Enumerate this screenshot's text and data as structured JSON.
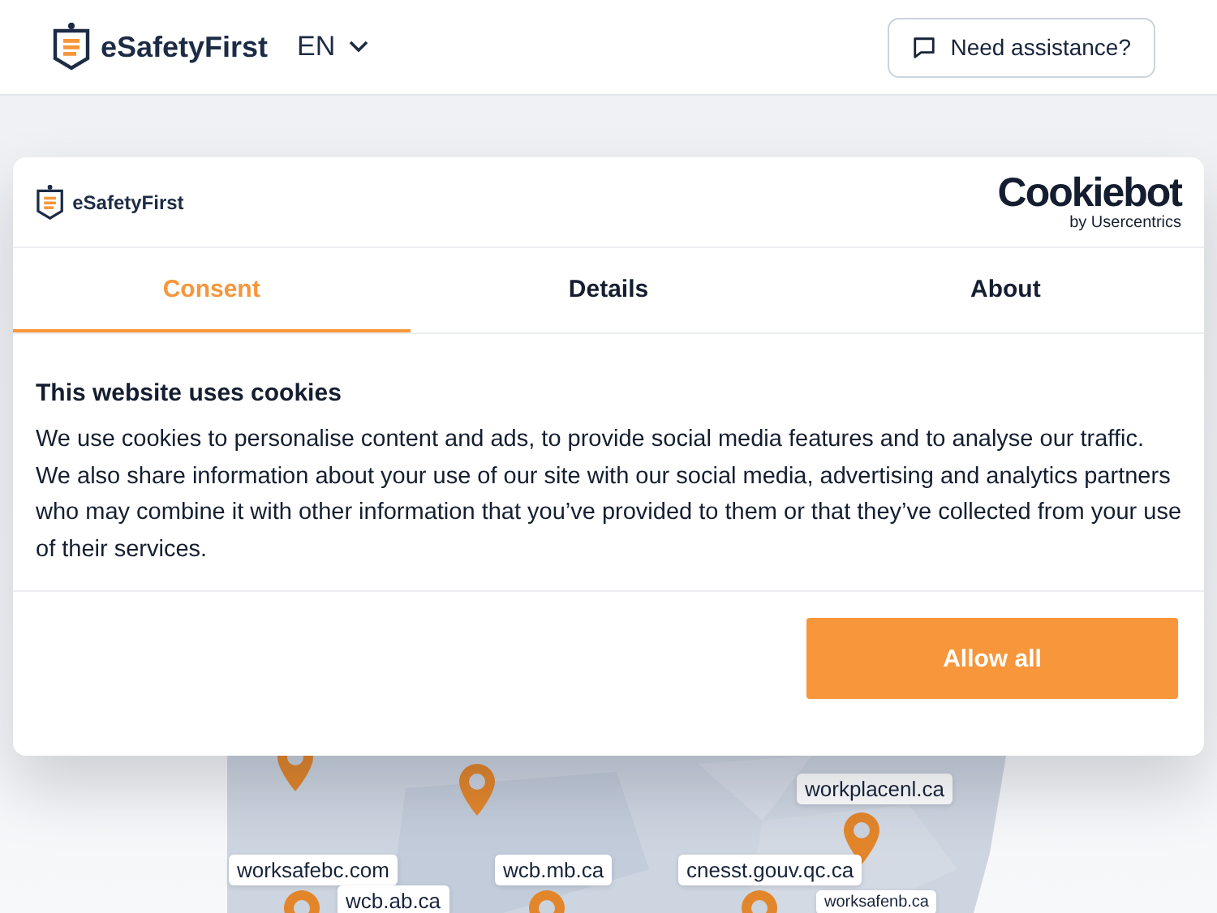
{
  "header": {
    "brand": "eSafetyFirst",
    "language": "EN",
    "help_button": "Need assistance?"
  },
  "hero": {
    "map_labels": [
      {
        "text": "workplacenl.ca"
      },
      {
        "text": "worksafebc.com"
      },
      {
        "text": "wcb.mb.ca"
      },
      {
        "text": "cnesst.gouv.qc.ca"
      },
      {
        "text": "wcb.ab.ca"
      },
      {
        "text": "worksafenb.ca"
      }
    ]
  },
  "cookie_dialog": {
    "brand": "eSafetyFirst",
    "provider": "Cookiebot",
    "provider_sub": "by Usercentrics",
    "tabs": [
      {
        "label": "Consent",
        "selected": true
      },
      {
        "label": "Details",
        "selected": false
      },
      {
        "label": "About",
        "selected": false
      }
    ],
    "title": "This website uses cookies",
    "body": "We use cookies to personalise content and ads, to provide social media features and to analyse our traffic. We also share information about your use of our site with our social media, advertising and analytics partners who may combine it with other information that you’ve provided to them or that they’ve collected from your use of their services.",
    "button": "Allow all"
  }
}
